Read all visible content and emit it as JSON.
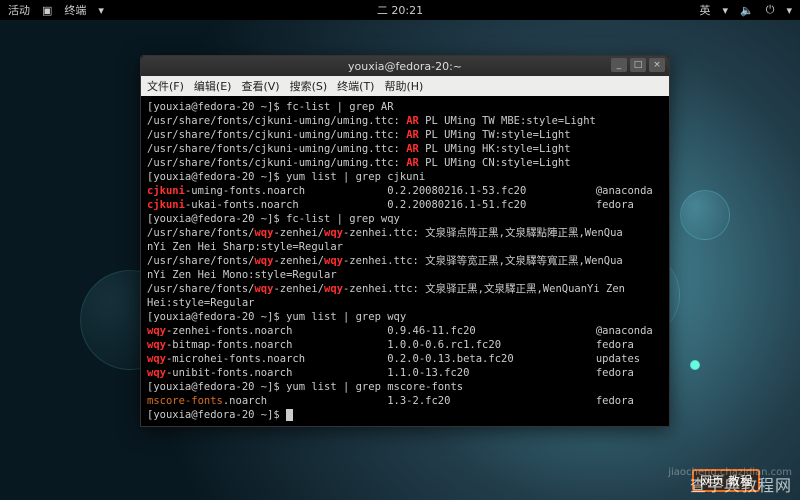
{
  "topbar": {
    "activities": "活动",
    "app": "终端",
    "clock": "二 20:21",
    "lang": "英",
    "volume_icon": "🔈",
    "power_icon": "⏻",
    "down_icon": "▾"
  },
  "window": {
    "title": "youxia@fedora-20:~",
    "menu": {
      "file": "文件(F)",
      "edit": "编辑(E)",
      "view": "查看(V)",
      "search": "搜索(S)",
      "terminal": "终端(T)",
      "help": "帮助(H)"
    },
    "btn_min": "_",
    "btn_max": "□",
    "btn_close": "×"
  },
  "term": {
    "prompt": "[youxia@fedora-20 ~]$ ",
    "cmd1": "fc-list | grep AR",
    "ar_lines": [
      {
        "path": "/usr/share/fonts/cjkuni-uming/uming.ttc: ",
        "hl": "AR",
        "rest": " PL UMing TW MBE:style=Light"
      },
      {
        "path": "/usr/share/fonts/cjkuni-uming/uming.ttc: ",
        "hl": "AR",
        "rest": " PL UMing TW:style=Light"
      },
      {
        "path": "/usr/share/fonts/cjkuni-uming/uming.ttc: ",
        "hl": "AR",
        "rest": " PL UMing HK:style=Light"
      },
      {
        "path": "/usr/share/fonts/cjkuni-uming/uming.ttc: ",
        "hl": "AR",
        "rest": " PL UMing CN:style=Light"
      }
    ],
    "cmd2": "yum list | grep cjkuni",
    "yum_cjk": [
      {
        "hl": "cjkuni",
        "name": "-uming-fonts.noarch",
        "ver": "0.2.20080216.1-53.fc20",
        "repo": "@anaconda"
      },
      {
        "hl": "cjkuni",
        "name": "-ukai-fonts.noarch",
        "ver": "0.2.20080216.1-51.fc20",
        "repo": "fedora"
      }
    ],
    "cmd3": "fc-list | grep wqy",
    "wqy_fc": [
      {
        "pre": "/usr/share/fonts/",
        "hl": "wqy",
        "mid": "-zenhei/",
        "hl2": "wqy",
        "post": "-zenhei.ttc: 文泉驿点阵正黑,文泉驛點陣正黑,WenQua"
      },
      {
        "pre": "nYi Zen Hei Sharp:style=Regular",
        "hl": "",
        "mid": "",
        "hl2": "",
        "post": ""
      },
      {
        "pre": "/usr/share/fonts/",
        "hl": "wqy",
        "mid": "-zenhei/",
        "hl2": "wqy",
        "post": "-zenhei.ttc: 文泉驿等宽正黑,文泉驛等寬正黑,WenQua"
      },
      {
        "pre": "nYi Zen Hei Mono:style=Regular",
        "hl": "",
        "mid": "",
        "hl2": "",
        "post": ""
      },
      {
        "pre": "/usr/share/fonts/",
        "hl": "wqy",
        "mid": "-zenhei/",
        "hl2": "wqy",
        "post": "-zenhei.ttc: 文泉驿正黑,文泉驛正黑,WenQuanYi Zen "
      },
      {
        "pre": "Hei:style=Regular",
        "hl": "",
        "mid": "",
        "hl2": "",
        "post": ""
      }
    ],
    "cmd4": "yum list | grep wqy",
    "yum_wqy": [
      {
        "hl": "wqy",
        "name": "-zenhei-fonts.noarch",
        "ver": "0.9.46-11.fc20",
        "repo": "@anaconda"
      },
      {
        "hl": "wqy",
        "name": "-bitmap-fonts.noarch",
        "ver": "1.0.0-0.6.rc1.fc20",
        "repo": "fedora"
      },
      {
        "hl": "wqy",
        "name": "-microhei-fonts.noarch",
        "ver": "0.2.0-0.13.beta.fc20",
        "repo": "updates"
      },
      {
        "hl": "wqy",
        "name": "-unibit-fonts.noarch",
        "ver": "1.1.0-13.fc20",
        "repo": "fedora"
      }
    ],
    "cmd5": "yum list | grep mscore-fonts",
    "yum_ms": [
      {
        "hl": "mscore-fonts",
        "name": ".noarch",
        "ver": "1.3-2.fc20",
        "repo": "fedora"
      }
    ]
  },
  "watermark": {
    "main": "查字典教程网",
    "sub": "jiaocheng.chazidian.com",
    "box": "网页  教程"
  }
}
